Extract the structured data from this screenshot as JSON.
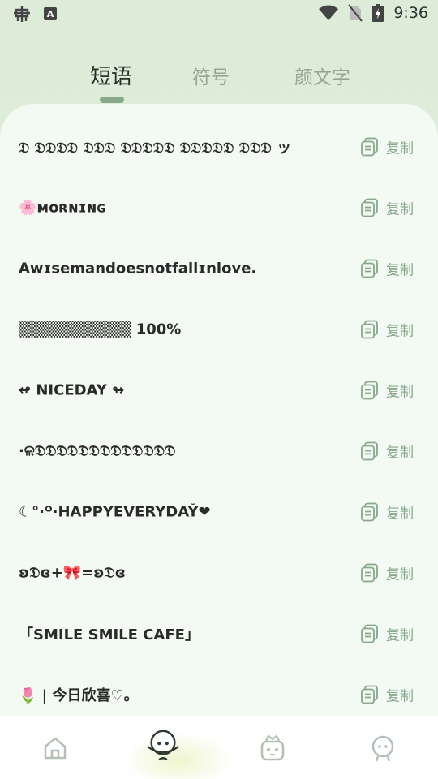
{
  "status_bar": {
    "time": "9:36",
    "left_icons": [
      "bug-icon",
      "a-keyboard-icon"
    ],
    "right_icons": [
      "wifi-icon",
      "no-sim-icon",
      "battery-charging-icon"
    ],
    "a_label": "A"
  },
  "tabs": [
    {
      "label": "短语",
      "active": true
    },
    {
      "label": "符号",
      "active": false
    },
    {
      "label": "颜文字",
      "active": false
    }
  ],
  "copy_label": "复制",
  "phrases": [
    "𝔇 𝔇𝔇𝔇𝔇 𝔇𝔇𝔇 𝔇𝔇𝔇𝔇𝔇 𝔇𝔇𝔇𝔇𝔇 𝔇𝔇𝔇  ッ",
    "🌸ᴍᴏʀɴɪɴɢ",
    "Aᴡɪsemandoesnotfallɪnlove.",
    "▒▒▒▒▒▒▒▒▒▒ 100%",
    "↫ NICEDAY ↬",
    "·ଳ𝔇𝔇𝔇𝔇𝔇𝔇𝔇𝔇𝔇𝔇𝔇𝔇𝔇",
    "☾°·ᴼ·HAPPYEVERYDAY̆❤",
    "ʚ𝔇ɞ+🎀=ʚ𝔇ɞ",
    "「SMILE SMILE CAFE」",
    "🌷 | 今日欣喜♡。"
  ],
  "colors": {
    "accent": "#86a98a",
    "background_top": "#dcecd8",
    "card": "#f3f9f3",
    "active_tab": "#2a2f2a",
    "inactive_tab": "#9aa496"
  },
  "bottom_nav": [
    {
      "icon": "home-icon",
      "active": false
    },
    {
      "icon": "planet-face-icon",
      "active": true
    },
    {
      "icon": "robot-crown-icon",
      "active": false
    },
    {
      "icon": "person-face-icon",
      "active": false
    }
  ]
}
